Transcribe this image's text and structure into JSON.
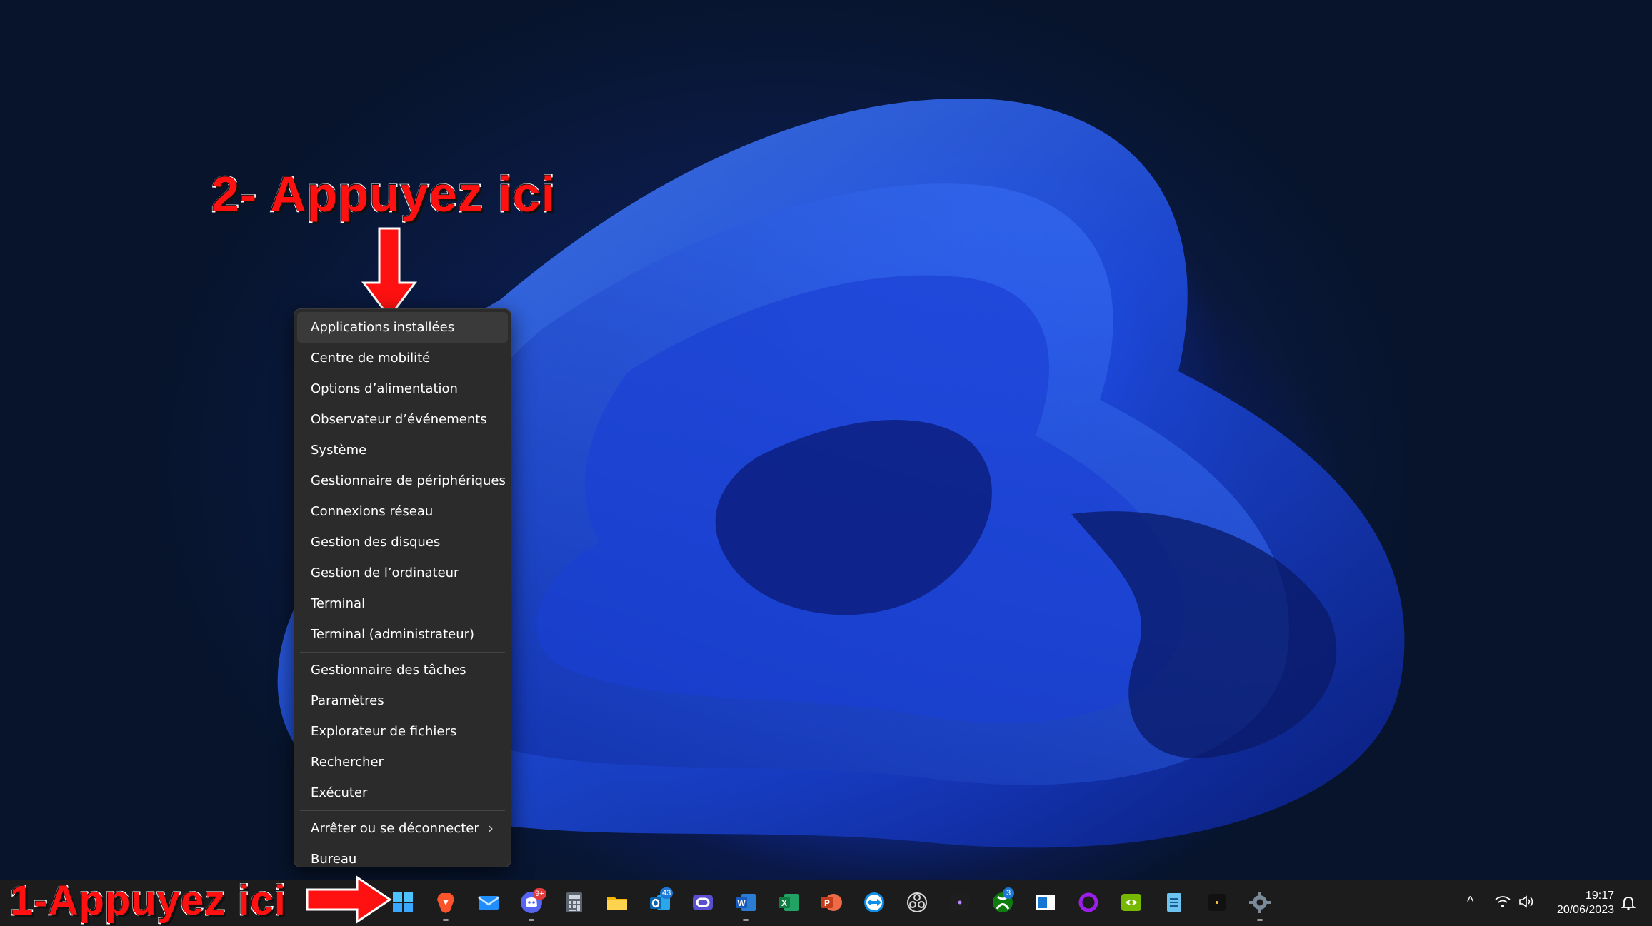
{
  "annotations": {
    "step2": "2- Appuyez ici",
    "step1": "1-Appuyez ici"
  },
  "context_menu": {
    "items": [
      "Applications installées",
      "Centre de mobilité",
      "Options d’alimentation",
      "Observateur d’événements",
      "Système",
      "Gestionnaire de périphériques",
      "Connexions réseau",
      "Gestion des disques",
      "Gestion de l’ordinateur",
      "Terminal",
      "Terminal (administrateur)",
      "Gestionnaire des tâches",
      "Paramètres",
      "Explorateur de fichiers",
      "Rechercher",
      "Exécuter",
      "Arrêter ou se déconnecter",
      "Bureau"
    ],
    "submenu_glyph": "›"
  },
  "taskbar": {
    "apps": [
      {
        "name": "start-icon"
      },
      {
        "name": "brave-icon"
      },
      {
        "name": "mail-icon"
      },
      {
        "name": "discord-icon",
        "badge": "9+"
      },
      {
        "name": "calculator-icon"
      },
      {
        "name": "file-explorer-icon"
      },
      {
        "name": "outlook-icon",
        "badge": "43"
      },
      {
        "name": "opera-icon"
      },
      {
        "name": "word-icon"
      },
      {
        "name": "excel-icon"
      },
      {
        "name": "powerpoint-icon"
      },
      {
        "name": "teamviewer-icon"
      },
      {
        "name": "obs-icon"
      },
      {
        "name": "terminal-icon"
      },
      {
        "name": "xbox-icon",
        "badge": "3"
      },
      {
        "name": "window-app-icon"
      },
      {
        "name": "cortana-icon"
      },
      {
        "name": "nvidia-icon"
      },
      {
        "name": "notepad-icon"
      },
      {
        "name": "sticky-app-icon"
      },
      {
        "name": "settings-icon"
      }
    ]
  },
  "tray": {
    "chevron": "^",
    "time": "19:17",
    "date": "20/06/2023"
  },
  "colors": {
    "annotation": "#ff1111",
    "menu_bg": "#2b2b2b",
    "taskbar_bg": "#1c1c1c"
  }
}
